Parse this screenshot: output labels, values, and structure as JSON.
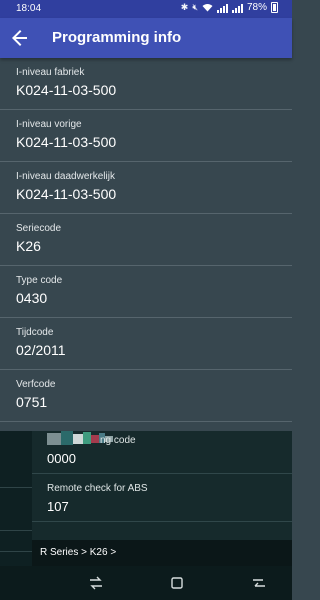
{
  "statusbar": {
    "time": "18:04",
    "battery": "78%"
  },
  "toolbar": {
    "title": "Programming info",
    "back_icon": "arrow-left-icon"
  },
  "items": [
    {
      "label": "I-niveau fabriek",
      "value": "K024-11-03-500"
    },
    {
      "label": "I-niveau vorige",
      "value": "K024-11-03-500"
    },
    {
      "label": "I-niveau daadwerkelijk",
      "value": "K024-11-03-500"
    },
    {
      "label": "Seriecode",
      "value": "K26"
    },
    {
      "label": "Type code",
      "value": "0430"
    },
    {
      "label": "Tijdcode",
      "value": "02/2011"
    },
    {
      "label": "Verfcode",
      "value": "0751"
    }
  ],
  "overlay": {
    "items": [
      {
        "label": "ng code",
        "value": "0000"
      },
      {
        "label": "Remote check for ABS",
        "value": "107"
      }
    ],
    "breadcrumb": "R Series > K26 >"
  },
  "navbar": {
    "recent_icon": "recent-apps-icon",
    "home_icon": "home-icon",
    "back_icon": "back-icon"
  }
}
